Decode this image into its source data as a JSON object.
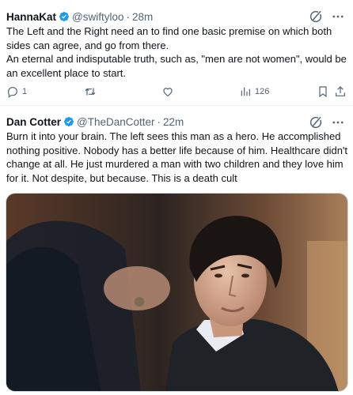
{
  "tweets": [
    {
      "display_name": "HannaKat",
      "handle": "@swiftyloo",
      "separator": "·",
      "time": "28m",
      "text_lines": [
        "The Left and the Right need an to find one basic premise on which both sides can agree, and go from there.",
        "An eternal and indisputable truth, such as, \"men are not women\", would be an excellent place to start."
      ],
      "stats": {
        "replies": "1",
        "views": "126"
      }
    },
    {
      "display_name": "Dan Cotter",
      "handle": "@TheDanCotter",
      "separator": "·",
      "time": "22m",
      "text": "Burn it into your brain. The left sees this man as a hero. He accomplished nothing positive. Nobody has a better life because of him. Healthcare didn't change at all. He just murdered a man with two children and they love him for it. Not despite, but because. This is a death cult"
    }
  ],
  "icons": {
    "verified": "verified-badge-icon",
    "grok": "grok-icon",
    "more": "more-icon",
    "reply": "reply-icon",
    "retweet": "retweet-icon",
    "like": "like-icon",
    "views": "views-icon",
    "bookmark": "bookmark-icon",
    "share": "share-icon"
  },
  "colors": {
    "text": "#0f1419",
    "secondary": "#536471",
    "verified": "#1d9bf0",
    "divider": "#eff3f4"
  }
}
